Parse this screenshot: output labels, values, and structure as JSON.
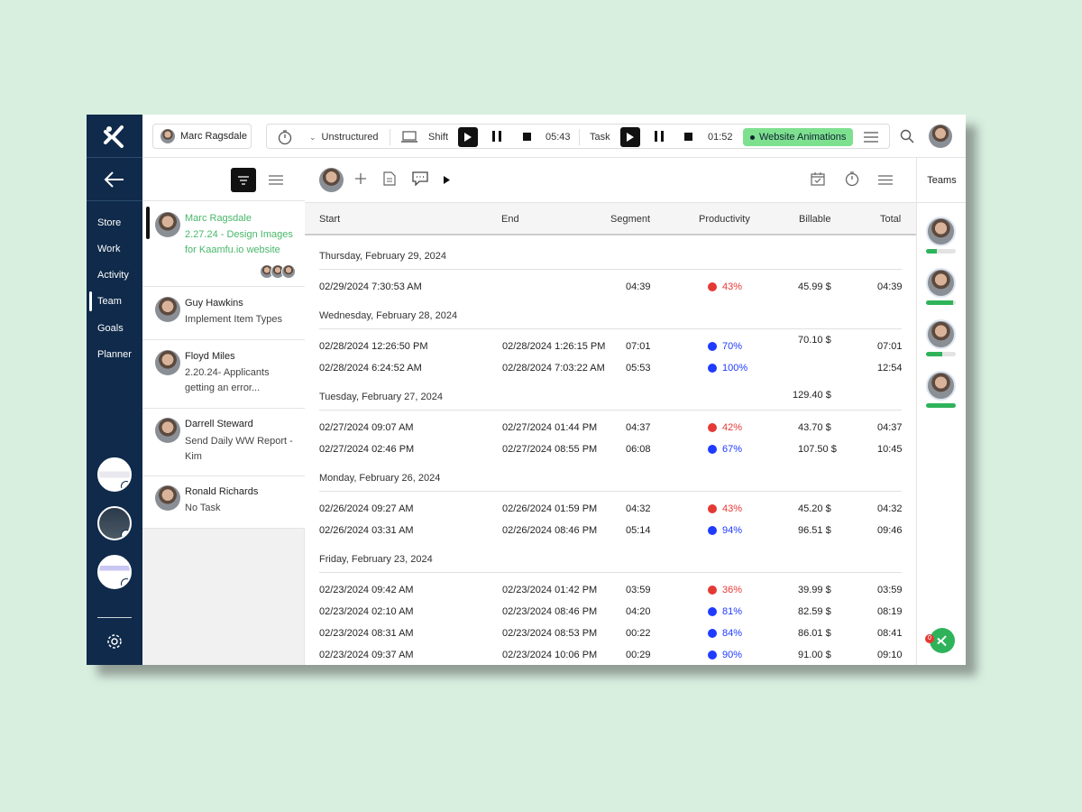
{
  "colors": {
    "nav_bg": "#0f2a4a",
    "accent_green": "#49b76a",
    "task_tag_bg": "#7de08f",
    "prod_low": "#e53935",
    "prod_high": "#1f3bff"
  },
  "nav": {
    "items": [
      "Store",
      "Work",
      "Activity",
      "Team",
      "Goals",
      "Planner"
    ],
    "active": "Team"
  },
  "topbar": {
    "user_name": "Marc Ragsdale",
    "mode": "Unstructured",
    "shift_label": "Shift",
    "shift_time": "05:43",
    "task_label": "Task",
    "task_time": "01:52",
    "task_tag": "Website Animations"
  },
  "list": [
    {
      "name": "Marc Ragsdale",
      "task": "2.27.24 - Design Images for Kaamfu.io website",
      "active": true
    },
    {
      "name": "Guy Hawkins",
      "task": "Implement Item Types"
    },
    {
      "name": "Floyd Miles",
      "task": "2.20.24- Applicants getting an error..."
    },
    {
      "name": "Darrell Steward",
      "task": "Send Daily WW Report - Kim"
    },
    {
      "name": "Ronald Richards",
      "task": "No Task"
    }
  ],
  "table": {
    "headers": {
      "start": "Start",
      "end": "End",
      "segment": "Segment",
      "productivity": "Productivity",
      "billable": "Billable",
      "total": "Total"
    },
    "days": [
      {
        "label": "Thursday, February 29, 2024",
        "rows": [
          {
            "start": "02/29/2024 7:30:53 AM",
            "end": "",
            "segment": "04:39",
            "prod": "43%",
            "level": "low",
            "billable": "45.99 $",
            "total": "04:39"
          }
        ]
      },
      {
        "label": "Wednesday, February 28, 2024",
        "rows": [
          {
            "start": "02/28/2024 12:26:50 PM",
            "end": "02/28/2024 1:26:15 PM",
            "segment": "07:01",
            "prod": "70%",
            "level": "high",
            "billable": "70.10 $",
            "total": "07:01"
          },
          {
            "start": "02/28/2024 6:24:52 AM",
            "end": "02/28/2024 7:03:22 AM",
            "segment": "05:53",
            "prod": "100%",
            "level": "high",
            "billable": "",
            "total": "12:54"
          }
        ]
      },
      {
        "label": "Tuesday, February 27, 2024",
        "day_billable": "129.40 $",
        "rows": [
          {
            "start": "02/27/2024 09:07 AM",
            "end": "02/27/2024 01:44 PM",
            "segment": "04:37",
            "prod": "42%",
            "level": "low",
            "billable": "43.70 $",
            "total": "04:37"
          },
          {
            "start": "02/27/2024 02:46 PM",
            "end": "02/27/2024 08:55 PM",
            "segment": "06:08",
            "prod": "67%",
            "level": "high",
            "billable": "107.50 $",
            "total": "10:45"
          }
        ]
      },
      {
        "label": "Monday, February 26, 2024",
        "rows": [
          {
            "start": "02/26/2024 09:27 AM",
            "end": "02/26/2024 01:59 PM",
            "segment": "04:32",
            "prod": "43%",
            "level": "low",
            "billable": "45.20 $",
            "total": "04:32"
          },
          {
            "start": "02/26/2024 03:31 AM",
            "end": "02/26/2024 08:46 PM",
            "segment": "05:14",
            "prod": "94%",
            "level": "high",
            "billable": "96.51 $",
            "total": "09:46"
          }
        ]
      },
      {
        "label": "Friday, February 23, 2024",
        "rows": [
          {
            "start": "02/23/2024 09:42 AM",
            "end": "02/23/2024 01:42 PM",
            "segment": "03:59",
            "prod": "36%",
            "level": "low",
            "billable": "39.99 $",
            "total": "03:59"
          },
          {
            "start": "02/23/2024 02:10 AM",
            "end": "02/23/2024 08:46 PM",
            "segment": "04:20",
            "prod": "81%",
            "level": "high",
            "billable": "82.59 $",
            "total": "08:19"
          },
          {
            "start": "02/23/2024 08:31 AM",
            "end": "02/23/2024 08:53 PM",
            "segment": "00:22",
            "prod": "84%",
            "level": "high",
            "billable": "86.01 $",
            "total": "08:41"
          },
          {
            "start": "02/23/2024 09:37 AM",
            "end": "02/23/2024 10:06 PM",
            "segment": "00:29",
            "prod": "90%",
            "level": "high",
            "billable": "91.00 $",
            "total": "09:10"
          }
        ]
      }
    ]
  },
  "teams": {
    "label": "Teams",
    "members": [
      {
        "progress": 0.35
      },
      {
        "progress": 0.9
      },
      {
        "progress": 0.55
      },
      {
        "progress": 1.0
      }
    ],
    "chat_badge": "0"
  }
}
